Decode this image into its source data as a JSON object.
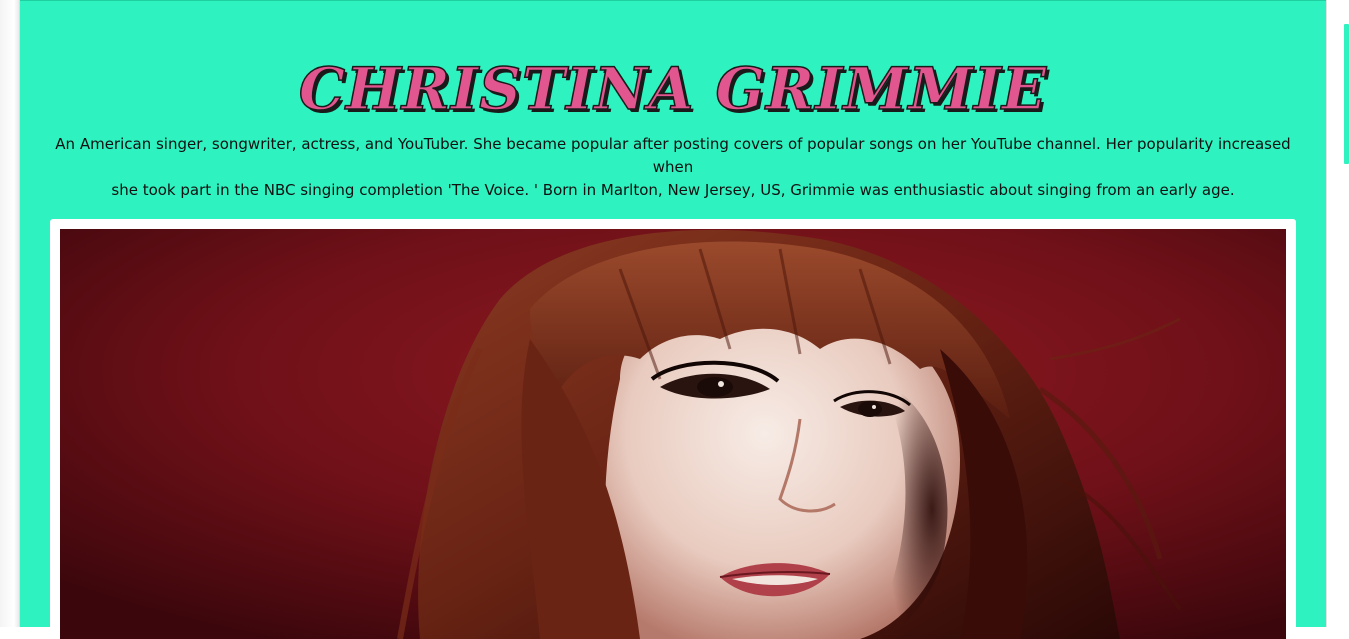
{
  "header": {
    "title": "CHRISTINA GRIMMIE"
  },
  "intro": {
    "line1": "An American singer, songwriter, actress, and YouTuber. She became popular after posting covers of popular songs on her YouTube channel. Her popularity increased when",
    "line2": "she took part in the NBC singing completion 'The Voice. ' Born in Marlton, New Jersey, US, Grimmie was enthusiastic about singing from an early age."
  },
  "colors": {
    "background": "#2ef2bf",
    "title_fill": "#e2568f",
    "title_outline": "#1a1a1a",
    "text": "#111111",
    "photo_background": "#7a1118",
    "card": "#ffffff"
  },
  "icons": {
    "portrait": "portrait-photo"
  }
}
